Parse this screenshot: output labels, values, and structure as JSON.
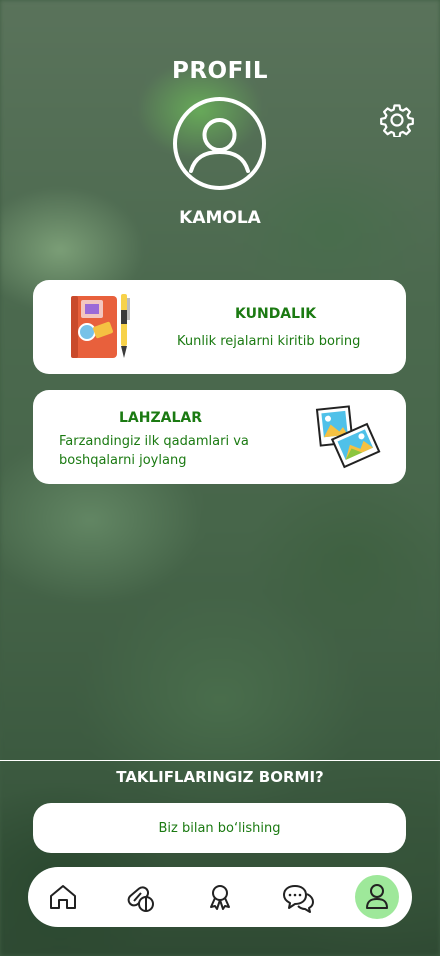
{
  "header": {
    "title": "PROFIL"
  },
  "profile": {
    "name": "KAMOLA"
  },
  "cards": [
    {
      "title": "KUNDALIK",
      "description": "Kunlik rejalarni kiritib boring"
    },
    {
      "title": "LAHZALAR",
      "description": "Farzandingiz ilk qadamlari va boshqalarni joylang"
    }
  ],
  "feedback": {
    "question": "TAKLIFLARINGIZ BORMI?",
    "button_label": "Biz bilan bo‘lishing"
  },
  "bottom_nav": {
    "items": [
      {
        "icon": "home-icon"
      },
      {
        "icon": "pills-icon"
      },
      {
        "icon": "award-ribbon-icon"
      },
      {
        "icon": "chat-icon"
      },
      {
        "icon": "user-icon",
        "active": true
      }
    ]
  },
  "colors": {
    "accent_text": "#1b7a12",
    "nav_active": "#9ee89a"
  }
}
